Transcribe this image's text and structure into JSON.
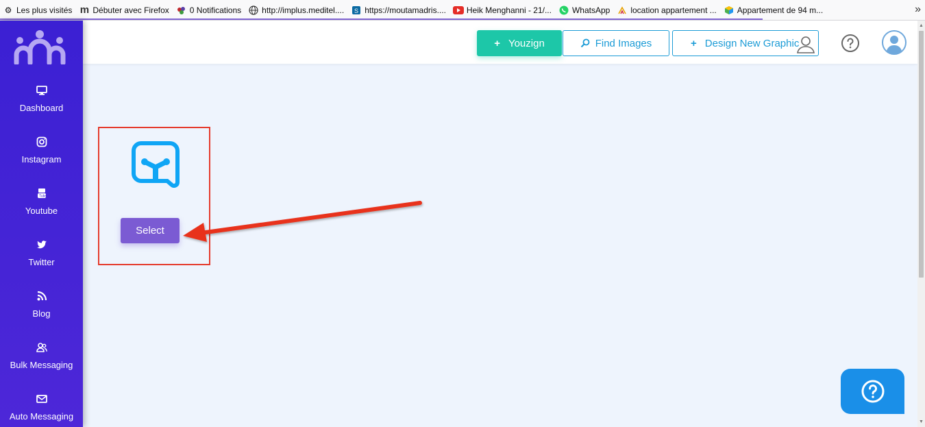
{
  "bookmarks": [
    {
      "label": "Les plus visités",
      "icon": "gear-icon"
    },
    {
      "label": "Débuter avec Firefox",
      "icon": "m-logo-icon"
    },
    {
      "label": "0 Notifications",
      "icon": "berries-icon"
    },
    {
      "label": "http://implus.meditel....",
      "icon": "globe-icon"
    },
    {
      "label": "https://moutamadris....",
      "icon": "sharepoint-icon"
    },
    {
      "label": "Heik Menghanni - 21/...",
      "icon": "youtube-icon"
    },
    {
      "label": "WhatsApp",
      "icon": "whatsapp-icon"
    },
    {
      "label": "location appartement ...",
      "icon": "house-icon"
    },
    {
      "label": "Appartement de 94 m...",
      "icon": "cube-icon"
    }
  ],
  "sidebar": {
    "items": [
      {
        "label": "Dashboard",
        "icon": "monitor-icon"
      },
      {
        "label": "Instagram",
        "icon": "instagram-icon"
      },
      {
        "label": "Youtube",
        "icon": "youtube-icon"
      },
      {
        "label": "Twitter",
        "icon": "twitter-icon"
      },
      {
        "label": "Blog",
        "icon": "rss-icon"
      },
      {
        "label": "Bulk Messaging",
        "icon": "users-icon"
      },
      {
        "label": "Auto Messaging",
        "icon": "envelope-icon"
      }
    ]
  },
  "header": {
    "youzign_label": "Youzign",
    "find_images_label": "Find Images",
    "design_label": "Design New Graphic"
  },
  "main": {
    "select_label": "Select"
  },
  "colors": {
    "sidebar": "#3b20d3",
    "youzign_button": "#1dc7a8",
    "outline_button": "#1b9bd6",
    "select_button": "#7b5bd3",
    "highlight": "#e53a2c",
    "help_widget": "#1a8fe8",
    "background": "#eef4fd"
  }
}
